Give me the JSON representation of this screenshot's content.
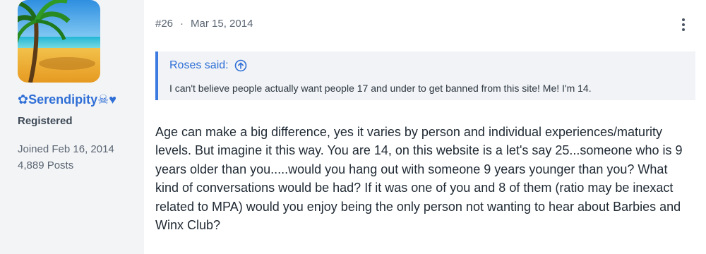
{
  "user": {
    "username": "✿Serendipity☠♥",
    "title": "Registered",
    "joined": "Joined Feb 16, 2014",
    "posts": "4,889 Posts"
  },
  "post": {
    "number": "#26",
    "separator": "·",
    "date": "Mar 15, 2014",
    "more_icon": "more-vertical-icon",
    "quote": {
      "author_label": "Roses said:",
      "icon": "arrow-up-circle-icon",
      "text": "I can't believe people actually want people 17 and under to get banned from this site! Me! I'm 14."
    },
    "body": "Age can make a big difference, yes it varies by person and individual experiences/maturity levels. But imagine it this way. You are 14, on this website is a let's say 25...someone who is 9 years older than you.....would you hang out with someone 9 years younger than you? What kind of conversations would be had? If it was one of you and 8 of them (ratio may be inexact related to MPA) would you enjoy being the only person not wanting to hear about Barbies and Winx Club?"
  },
  "colors": {
    "accent": "#2f6fd6",
    "page_bg": "#f3f4f6",
    "card_bg": "#ffffff",
    "quote_bg": "#f1f3f6"
  }
}
